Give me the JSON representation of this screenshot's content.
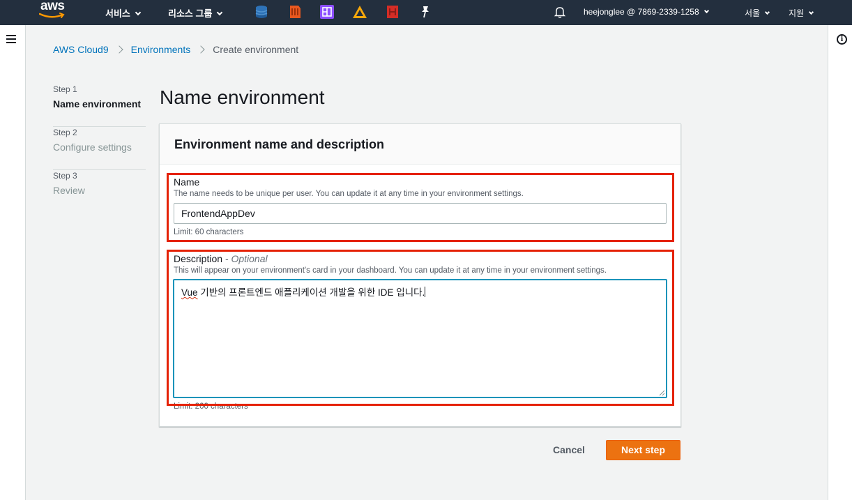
{
  "topnav": {
    "logo_text": "aws",
    "services_label": "서비스",
    "resource_groups_label": "리소스 그룹",
    "account_label": "heejonglee @ 7869-2339-1258",
    "region_label": "서울",
    "support_label": "지원",
    "pinned_services": [
      {
        "name": "dynamodb-icon",
        "color": "#2e73b8"
      },
      {
        "name": "cloud9-icon",
        "color": "#e9581f"
      },
      {
        "name": "workdocs-icon",
        "color": "#8c4fff"
      },
      {
        "name": "athena-icon",
        "color": "#f7a80b"
      },
      {
        "name": "codepipeline-icon",
        "color": "#d42d26"
      }
    ]
  },
  "breadcrumb": {
    "items": [
      "AWS Cloud9",
      "Environments"
    ],
    "current": "Create environment"
  },
  "steps": [
    {
      "num": "Step 1",
      "label": "Name environment"
    },
    {
      "num": "Step 2",
      "label": "Configure settings"
    },
    {
      "num": "Step 3",
      "label": "Review"
    }
  ],
  "page_title": "Name environment",
  "card": {
    "title": "Environment name and description",
    "name_field": {
      "label": "Name",
      "description": "The name needs to be unique per user. You can update it at any time in your environment settings.",
      "value": "FrontendAppDev",
      "limit": "Limit: 60 characters"
    },
    "description_field": {
      "label": "Description",
      "optional": "- Optional",
      "description": "This will appear on your environment's card in your dashboard. You can update it at any time in your environment settings.",
      "value_prefix": "Vue",
      "value_rest": " 기반의 프론트엔드 애플리케이션 개발을 위한 IDE 입니다.",
      "limit": "Limit: 200 characters"
    }
  },
  "buttons": {
    "cancel": "Cancel",
    "next": "Next step"
  },
  "colors": {
    "nav_bg": "#232f3e",
    "link": "#0073bb",
    "primary_button": "#ec7211",
    "highlight": "#e52207",
    "focus": "#1b93ba"
  }
}
